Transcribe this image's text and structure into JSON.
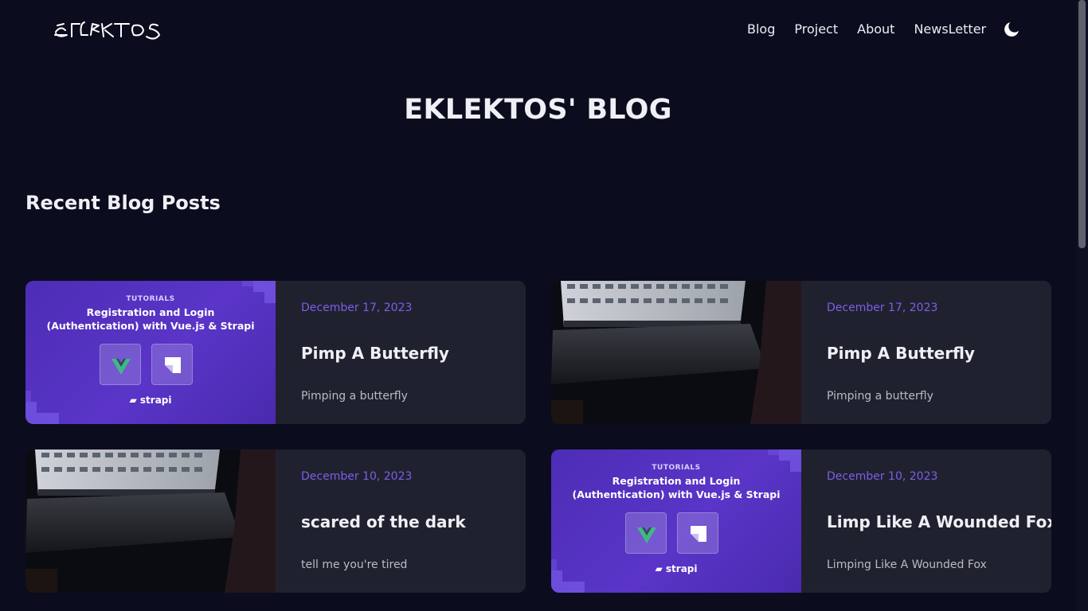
{
  "header": {
    "logo_text": "EKLEKTOS",
    "nav": [
      "Blog",
      "Project",
      "About",
      "NewsLetter"
    ],
    "theme_toggle_icon": "moon-icon"
  },
  "hero": {
    "title": "EKLEKTOS' BLOG"
  },
  "section": {
    "title": "Recent Blog Posts"
  },
  "thumbnail_strapi": {
    "label": "TUTORIALS",
    "title_line1": "Registration and Login",
    "title_line2": "(Authentication) with Vue.js & Strapi",
    "brand": "strapi"
  },
  "posts": [
    {
      "date": "December 17, 2023",
      "title": "Pimp A Butterfly",
      "excerpt": "Pimping a butterfly",
      "thumbnail": "strapi-tutorial"
    },
    {
      "date": "December 17, 2023",
      "title": "Pimp A Butterfly",
      "excerpt": "Pimping a butterfly",
      "thumbnail": "laptop-dark"
    },
    {
      "date": "December 10, 2023",
      "title": "scared of the dark",
      "excerpt": "tell me you're tired",
      "thumbnail": "laptop-dark"
    },
    {
      "date": "December 10, 2023",
      "title": "Limp Like A Wounded Fox",
      "excerpt": "Limping Like A Wounded Fox",
      "thumbnail": "strapi-tutorial"
    }
  ],
  "colors": {
    "background": "#0b0d1f",
    "card": "#20212f",
    "accent": "#7b5fe6"
  }
}
